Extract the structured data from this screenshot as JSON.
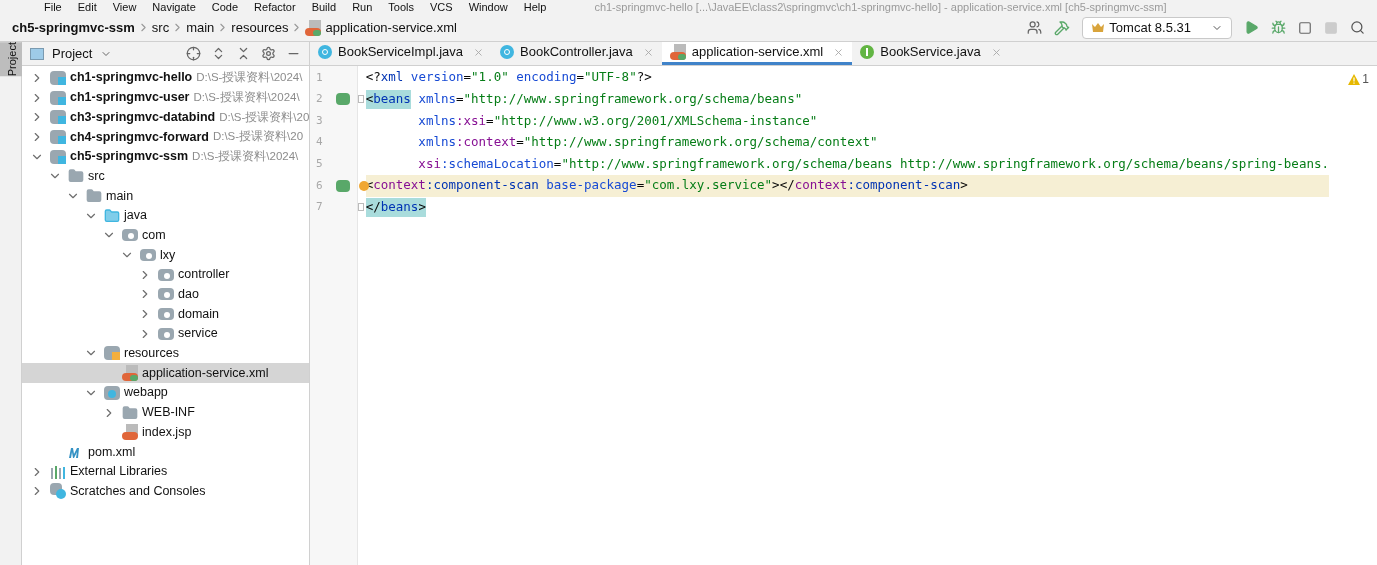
{
  "window": {
    "title": "ch1-springmvc-hello [...\\JavaEE\\class2\\springmvc\\ch1-springmvc-hello] - application-service.xml [ch5-springmvc-ssm]"
  },
  "menu": [
    "File",
    "Edit",
    "View",
    "Navigate",
    "Code",
    "Refactor",
    "Build",
    "Run",
    "Tools",
    "VCS",
    "Window",
    "Help"
  ],
  "breadcrumbs": [
    "ch5-springmvc-ssm",
    "src",
    "main",
    "resources",
    "application-service.xml"
  ],
  "toolbar": {
    "run_config": "Tomcat 8.5.31"
  },
  "side_stripe": {
    "label": "Project"
  },
  "project_panel": {
    "title": "Project",
    "tree": [
      {
        "label": "ch1-springmvc-hello",
        "hint": "D:\\S-授课资料\\2024\\",
        "kind": "module",
        "expanded": false,
        "selected": false
      },
      {
        "label": "ch1-springmvc-user",
        "hint": "D:\\S-授课资料\\2024\\",
        "kind": "module",
        "expanded": false,
        "selected": false
      },
      {
        "label": "ch3-springmvc-databind",
        "hint": "D:\\S-授课资料\\20",
        "kind": "module",
        "expanded": false,
        "selected": false
      },
      {
        "label": "ch4-springmvc-forward",
        "hint": "D:\\S-授课资料\\20",
        "kind": "module",
        "expanded": false,
        "selected": false
      },
      {
        "label": "ch5-springmvc-ssm",
        "hint": "D:\\S-授课资料\\2024\\",
        "kind": "module",
        "expanded": true,
        "selected": false,
        "children": [
          {
            "label": "src",
            "kind": "folder",
            "expanded": true,
            "selected": false,
            "children": [
              {
                "label": "main",
                "kind": "folder",
                "expanded": true,
                "selected": false,
                "children": [
                  {
                    "label": "java",
                    "kind": "source",
                    "expanded": true,
                    "selected": false,
                    "children": [
                      {
                        "label": "com",
                        "kind": "package",
                        "expanded": true,
                        "selected": false,
                        "children": [
                          {
                            "label": "lxy",
                            "kind": "package",
                            "expanded": true,
                            "selected": false,
                            "children": [
                              {
                                "label": "controller",
                                "kind": "package",
                                "expanded": false,
                                "selected": false
                              },
                              {
                                "label": "dao",
                                "kind": "package",
                                "expanded": false,
                                "selected": false
                              },
                              {
                                "label": "domain",
                                "kind": "package",
                                "expanded": false,
                                "selected": false
                              },
                              {
                                "label": "service",
                                "kind": "package",
                                "expanded": false,
                                "selected": false
                              }
                            ]
                          }
                        ]
                      }
                    ]
                  },
                  {
                    "label": "resources",
                    "kind": "resources",
                    "expanded": true,
                    "selected": false,
                    "children": [
                      {
                        "label": "application-service.xml",
                        "kind": "xml",
                        "selected": true
                      }
                    ]
                  },
                  {
                    "label": "webapp",
                    "kind": "webapp",
                    "expanded": true,
                    "selected": false,
                    "children": [
                      {
                        "label": "WEB-INF",
                        "kind": "folder",
                        "expanded": false,
                        "selected": false
                      },
                      {
                        "label": "index.jsp",
                        "kind": "jsp",
                        "selected": false
                      }
                    ]
                  }
                ]
              }
            ]
          },
          {
            "label": "pom.xml",
            "kind": "maven",
            "selected": false
          }
        ]
      },
      {
        "label": "External Libraries",
        "kind": "libraries",
        "expanded": false,
        "selected": false
      },
      {
        "label": "Scratches and Consoles",
        "kind": "scratches",
        "expanded": false,
        "selected": false
      }
    ]
  },
  "tabs": [
    {
      "label": "BookServiceImpl.java",
      "kind": "class",
      "selected": false
    },
    {
      "label": "BookController.java",
      "kind": "class",
      "selected": false
    },
    {
      "label": "application-service.xml",
      "kind": "xml",
      "selected": true
    },
    {
      "label": "BookService.java",
      "kind": "interface",
      "selected": false
    }
  ],
  "editor": {
    "warnings": "1",
    "lines": [
      {
        "number": "1",
        "highlighted": false,
        "gutter_icon": false,
        "fold": false,
        "bulb": false,
        "tokens": [
          {
            "kind": "punct",
            "text": "<?"
          },
          {
            "kind": "tag",
            "text": "xml"
          },
          {
            "kind": "attr",
            "text": " version"
          },
          {
            "kind": "punct",
            "text": "="
          },
          {
            "kind": "value",
            "text": "\"1.0\""
          },
          {
            "kind": "attr",
            "text": " encoding"
          },
          {
            "kind": "punct",
            "text": "="
          },
          {
            "kind": "value",
            "text": "\"UTF-8\""
          },
          {
            "kind": "punct",
            "text": "?>"
          }
        ]
      },
      {
        "number": "2",
        "highlighted": false,
        "gutter_icon": true,
        "fold": true,
        "bulb": false,
        "tokens": [
          {
            "kind": "punct",
            "text": "<",
            "matched": true
          },
          {
            "kind": "tag",
            "text": "beans",
            "matched": true
          },
          {
            "kind": "attr",
            "text": " xmlns"
          },
          {
            "kind": "punct",
            "text": "="
          },
          {
            "kind": "value",
            "text": "\"http://www.springframework.org/schema/beans\""
          }
        ]
      },
      {
        "number": "3",
        "highlighted": false,
        "gutter_icon": false,
        "fold": false,
        "bulb": false,
        "tokens": [
          {
            "kind": "attr",
            "text": "       xmlns"
          },
          {
            "kind": "ns",
            "text": ":xsi"
          },
          {
            "kind": "punct",
            "text": "="
          },
          {
            "kind": "value",
            "text": "\"http://www.w3.org/2001/XMLSchema-instance\""
          }
        ]
      },
      {
        "number": "4",
        "highlighted": false,
        "gutter_icon": false,
        "fold": false,
        "bulb": false,
        "tokens": [
          {
            "kind": "attr",
            "text": "       xmlns"
          },
          {
            "kind": "ns",
            "text": ":context"
          },
          {
            "kind": "punct",
            "text": "="
          },
          {
            "kind": "value",
            "text": "\"http://www.springframework.org/schema/context\""
          }
        ]
      },
      {
        "number": "5",
        "highlighted": false,
        "gutter_icon": false,
        "fold": false,
        "bulb": false,
        "tokens": [
          {
            "kind": "ns",
            "text": "       xsi"
          },
          {
            "kind": "attr",
            "text": ":schemaLocation"
          },
          {
            "kind": "punct",
            "text": "="
          },
          {
            "kind": "value",
            "text": "\"http://www.springframework.org/schema/beans http://www.springframework.org/schema/beans/spring-beans."
          }
        ]
      },
      {
        "number": "6",
        "highlighted": true,
        "gutter_icon": true,
        "fold": false,
        "bulb": true,
        "tokens": [
          {
            "kind": "punct",
            "text": "<"
          },
          {
            "kind": "ns",
            "text": "context"
          },
          {
            "kind": "tag",
            "text": ":component-scan"
          },
          {
            "kind": "attr",
            "text": " base-package"
          },
          {
            "kind": "punct",
            "text": "="
          },
          {
            "kind": "value",
            "text": "\"com.lxy.service\""
          },
          {
            "kind": "punct",
            "text": "></"
          },
          {
            "kind": "ns",
            "text": "context"
          },
          {
            "kind": "tag",
            "text": ":component-scan"
          },
          {
            "kind": "punct",
            "text": ">"
          }
        ]
      },
      {
        "number": "7",
        "highlighted": false,
        "gutter_icon": false,
        "fold": true,
        "bulb": false,
        "tokens": [
          {
            "kind": "punct",
            "text": "</",
            "matched": true
          },
          {
            "kind": "tag",
            "text": "beans",
            "matched": true
          },
          {
            "kind": "punct",
            "text": ">",
            "matched": true
          }
        ]
      }
    ]
  }
}
